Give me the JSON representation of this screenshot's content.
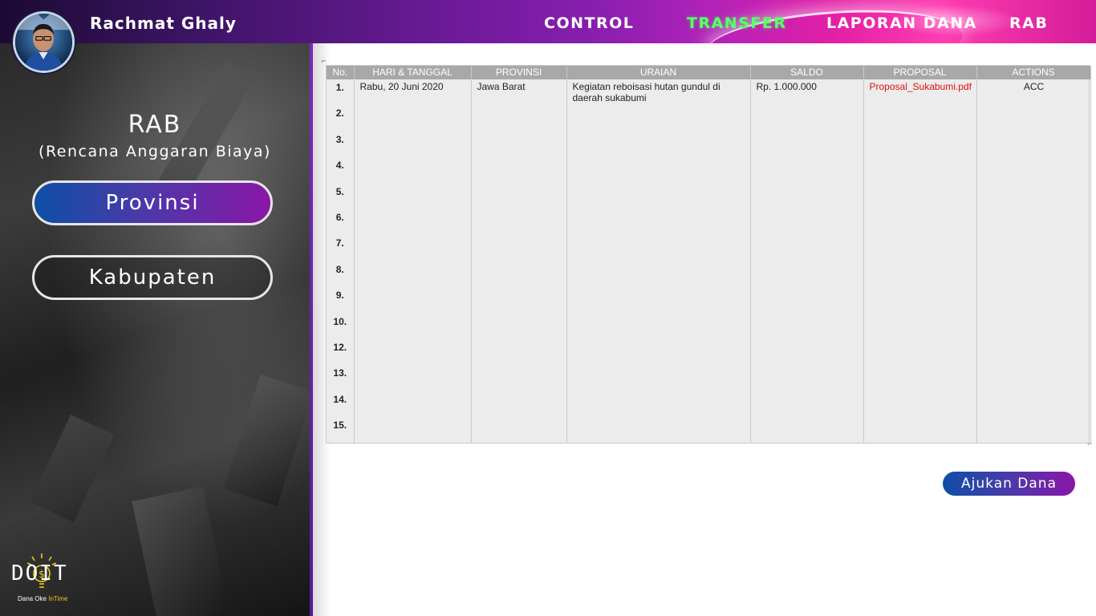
{
  "header": {
    "user_name": "Rachmat Ghaly",
    "nav": [
      {
        "label": "CONTROL",
        "active": false
      },
      {
        "label": "TRANSFER",
        "active": true
      },
      {
        "label": "LAPORAN DANA",
        "active": false
      },
      {
        "label": "RAB",
        "active": false
      }
    ],
    "active_color": "#5cff6a"
  },
  "sidebar": {
    "title": "RAB",
    "subtitle": "(Rencana Anggaran Biaya)",
    "buttons": [
      {
        "label": "Provinsi",
        "selected": true
      },
      {
        "label": "Kabupaten",
        "selected": false
      }
    ],
    "logo": {
      "text": "DOIT",
      "tagline_prefix": "Dana Oke ",
      "tagline_highlight": "InTime"
    }
  },
  "table": {
    "columns": [
      "No.",
      "HARI & TANGGAL",
      "PROVINSI",
      "URAIAN",
      "SALDO",
      "PROPOSAL",
      "ACTIONS"
    ],
    "row_numbers": [
      "1.",
      "2.",
      "3.",
      "4.",
      "5.",
      "6.",
      "7.",
      "8.",
      "9.",
      "10.",
      "12.",
      "13.",
      "14.",
      "15."
    ],
    "rows": [
      {
        "date": "Rabu, 20 Juni 2020",
        "provinsi": "Jawa Barat",
        "uraian": "Kegiatan reboisasi hutan gundul di daerah sukabumi",
        "saldo": "Rp. 1.000.000",
        "proposal": "Proposal_Sukabumi.pdf",
        "action": "ACC"
      }
    ]
  },
  "submit_button": "Ajukan Dana",
  "colors": {
    "accent_blue": "#0e4fa6",
    "accent_purple": "#8a16a8",
    "link_red": "#e01010"
  }
}
